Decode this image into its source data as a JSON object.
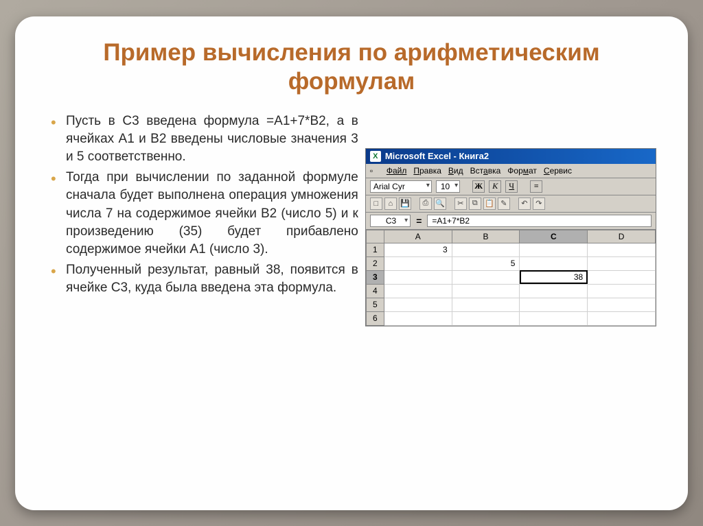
{
  "title": "Пример вычисления по арифметическим формулам",
  "bullets": [
    "Пусть в С3 введена формула =А1+7*В2, а в ячейках А1 и В2 введены числовые значения 3 и 5 соответственно.",
    "Тогда при вычислении по заданной формуле сначала будет выполнена операция умножения числа 7 на содержимое ячейки В2 (число 5) и к произведению (35) будет прибавлено содержимое ячейки А1 (число 3).",
    "Полученный результат, равный 38, появится в ячейке С3, куда была введена эта формула."
  ],
  "excel": {
    "app_title": "Microsoft Excel - Книга2",
    "menu": [
      "Файл",
      "Правка",
      "Вид",
      "Вставка",
      "Формат",
      "Сервис"
    ],
    "font": "Arial Cyr",
    "size": "10",
    "fmt": [
      "Ж",
      "К",
      "Ч"
    ],
    "namebox": "C3",
    "formula": "=A1+7*B2",
    "columns": [
      "A",
      "B",
      "C",
      "D"
    ],
    "rows": [
      "1",
      "2",
      "3",
      "4",
      "5",
      "6"
    ],
    "cells": {
      "A1": "3",
      "B2": "5",
      "C3": "38"
    },
    "active_col": "C",
    "active_row": "3"
  }
}
